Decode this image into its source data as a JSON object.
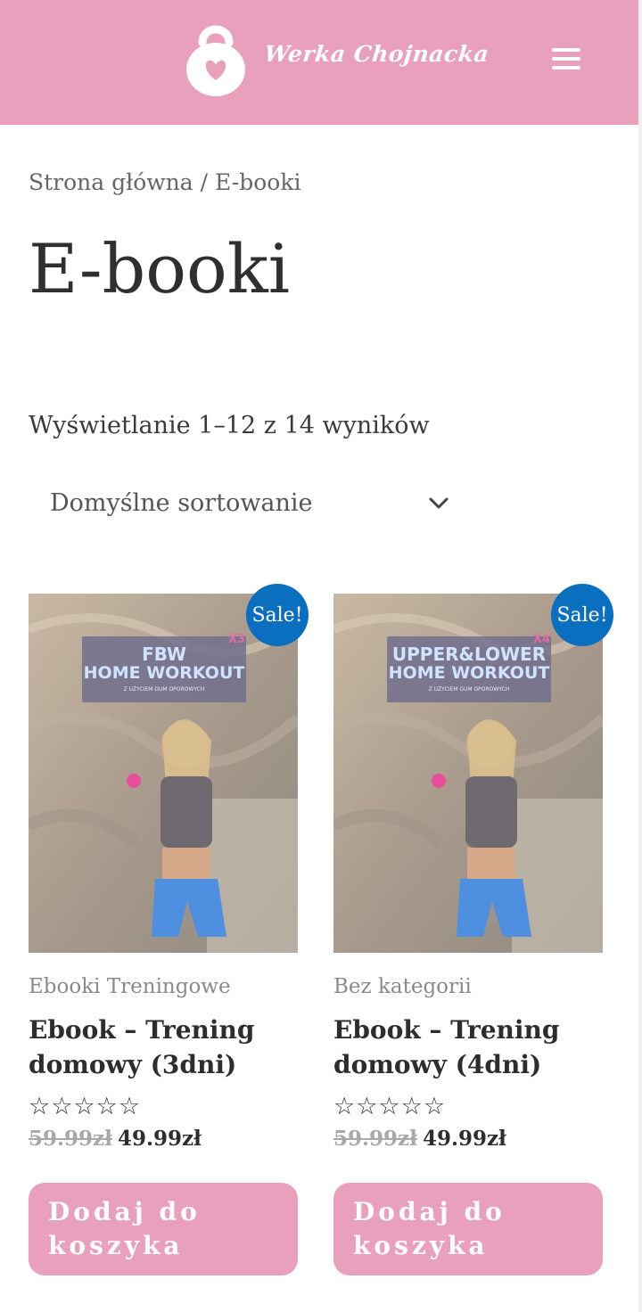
{
  "header": {
    "brand_text": "Werka Chojnacka",
    "logo_icon": "kettlebell-heart-icon",
    "menu_icon": "hamburger-menu-icon",
    "colors": {
      "header_bg": "#e8a0bd",
      "white": "#ffffff"
    }
  },
  "breadcrumb": {
    "home": "Strona główna",
    "separator": "/",
    "current": "E-booki"
  },
  "page": {
    "title": "E-booki",
    "result_count": "Wyświetlanie 1–12 z 14 wyników",
    "sort": {
      "selected": "Domyślne sortowanie",
      "icon": "chevron-down-icon"
    }
  },
  "products": [
    {
      "sale_badge": "Sale!",
      "cover_title_line1": "FBW",
      "cover_title_line2": "HOME WORKOUT",
      "cover_subtitle": "Z UŻYCIEM GUM OPOROWYCH",
      "cover_count": "X3",
      "category": "Ebooki Treningowe",
      "title": "Ebook – Trening domowy (3dni)",
      "rating_stars": "☆☆☆☆☆",
      "old_price": "59.99zł",
      "price": "49.99zł",
      "button": "Dodaj do koszyka"
    },
    {
      "sale_badge": "Sale!",
      "cover_title_line1": "UPPER&LOWER",
      "cover_title_line2": "HOME WORKOUT",
      "cover_subtitle": "Z UŻYCIEM GUM OPOROWYCH",
      "cover_count": "X4",
      "category": "Bez kategorii",
      "title": "Ebook – Trening domowy (4dni)",
      "rating_stars": "☆☆☆☆☆",
      "old_price": "59.99zł",
      "price": "49.99zł",
      "button": "Dodaj do koszyka"
    }
  ],
  "colors": {
    "accent_pink": "#e8a0bd",
    "sale_blue": "#0a6fbe"
  }
}
